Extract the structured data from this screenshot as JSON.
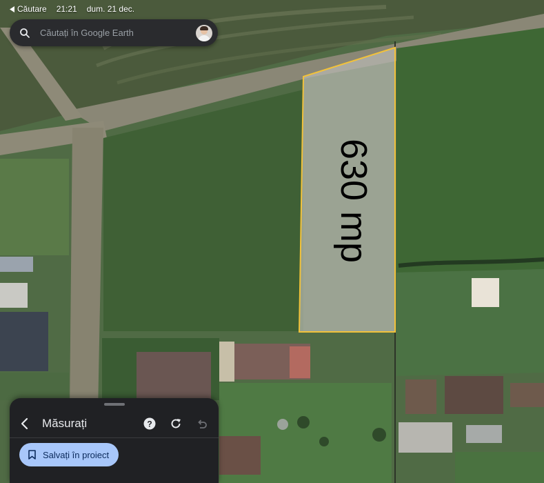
{
  "status_bar": {
    "back_label": "Căutare",
    "time": "21:21",
    "date": "dum. 21 dec."
  },
  "search": {
    "placeholder": "Căutați în Google Earth"
  },
  "map": {
    "area_label": "630 mp",
    "polygon_color": "#f2c23a"
  },
  "measure_panel": {
    "title": "Măsurați",
    "help_icon": "help-icon",
    "refresh_icon": "refresh-icon",
    "undo_icon": "undo-icon",
    "save_button": "Salvați în proiect",
    "save_icon": "bookmark-icon"
  }
}
